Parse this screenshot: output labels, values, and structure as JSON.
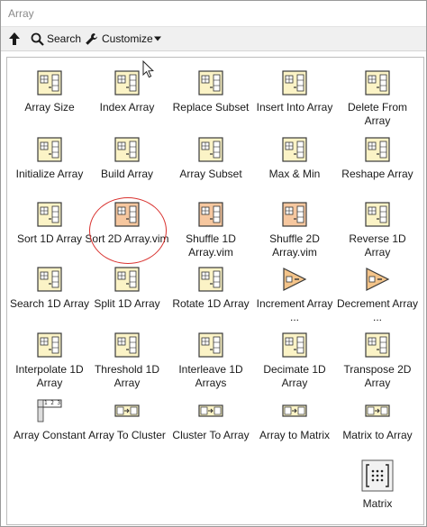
{
  "window": {
    "title": "Array"
  },
  "toolbar": {
    "search_label": "Search",
    "customize_label": "Customize"
  },
  "items": [
    {
      "label": "Array Size",
      "icon": "array-size-icon",
      "style": "beige"
    },
    {
      "label": "Index Array",
      "icon": "index-array-icon",
      "style": "beige"
    },
    {
      "label": "Replace Subset",
      "icon": "replace-subset-icon",
      "style": "beige"
    },
    {
      "label": "Insert Into Array",
      "icon": "insert-into-array-icon",
      "style": "beige"
    },
    {
      "label": "Delete From Array",
      "icon": "delete-from-array-icon",
      "style": "beige"
    },
    {
      "label": "Initialize Array",
      "icon": "initialize-array-icon",
      "style": "beige"
    },
    {
      "label": "Build Array",
      "icon": "build-array-icon",
      "style": "beige"
    },
    {
      "label": "Array Subset",
      "icon": "array-subset-icon",
      "style": "beige"
    },
    {
      "label": "Max & Min",
      "icon": "max-min-icon",
      "style": "beige"
    },
    {
      "label": "Reshape Array",
      "icon": "reshape-array-icon",
      "style": "beige"
    },
    {
      "label": "Sort 1D Array",
      "icon": "sort-1d-array-icon",
      "style": "beige"
    },
    {
      "label": "Sort 2D Array.vim",
      "icon": "sort-2d-array-icon",
      "style": "orange"
    },
    {
      "label": "Shuffle 1D Array.vim",
      "icon": "shuffle-1d-array-icon",
      "style": "orange"
    },
    {
      "label": "Shuffle 2D Array.vim",
      "icon": "shuffle-2d-array-icon",
      "style": "orange"
    },
    {
      "label": "Reverse 1D Array",
      "icon": "reverse-1d-array-icon",
      "style": "beige"
    },
    {
      "label": "Search 1D Array",
      "icon": "search-1d-array-icon",
      "style": "beige"
    },
    {
      "label": "Split 1D Array",
      "icon": "split-1d-array-icon",
      "style": "beige"
    },
    {
      "label": "Rotate 1D Array",
      "icon": "rotate-1d-array-icon",
      "style": "beige"
    },
    {
      "label": "Increment Array ...",
      "icon": "increment-array-icon",
      "style": "triangle"
    },
    {
      "label": "Decrement Array ...",
      "icon": "decrement-array-icon",
      "style": "triangle"
    },
    {
      "label": "Interpolate 1D Array",
      "icon": "interpolate-1d-array-icon",
      "style": "beige"
    },
    {
      "label": "Threshold 1D Array",
      "icon": "threshold-1d-array-icon",
      "style": "beige"
    },
    {
      "label": "Interleave 1D Arrays",
      "icon": "interleave-1d-arrays-icon",
      "style": "beige"
    },
    {
      "label": "Decimate 1D Array",
      "icon": "decimate-1d-array-icon",
      "style": "beige"
    },
    {
      "label": "Transpose 2D Array",
      "icon": "transpose-2d-array-icon",
      "style": "beige"
    },
    {
      "label": "Array Constant",
      "icon": "array-constant-icon",
      "style": "constant"
    },
    {
      "label": "Array To Cluster",
      "icon": "array-to-cluster-icon",
      "style": "conv"
    },
    {
      "label": "Cluster To Array",
      "icon": "cluster-to-array-icon",
      "style": "conv"
    },
    {
      "label": "Array to Matrix",
      "icon": "array-to-matrix-icon",
      "style": "conv"
    },
    {
      "label": "Matrix to Array",
      "icon": "matrix-to-array-icon",
      "style": "conv"
    },
    {
      "label": "Matrix",
      "icon": "matrix-icon",
      "style": "matrix"
    }
  ],
  "array_constant": {
    "digits": "1 2 3"
  },
  "colors": {
    "beige": "#fbf3c6",
    "orange": "#f6c79f",
    "triangle": "#f4c48a",
    "border": "#3a3a3a",
    "ring": "#d9322f"
  }
}
